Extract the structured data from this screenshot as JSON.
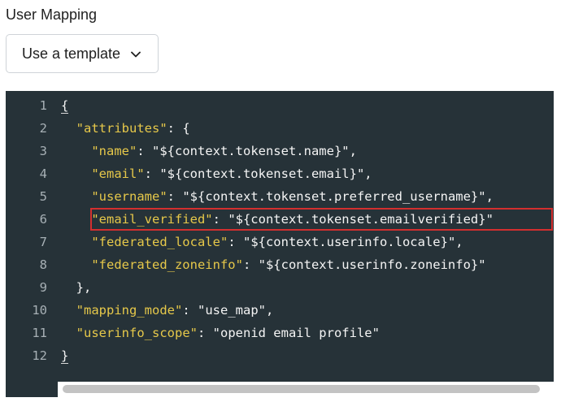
{
  "section": {
    "label": "User Mapping"
  },
  "template_dropdown": {
    "label": "Use a template",
    "icon": "chevron-down-icon"
  },
  "editor": {
    "line_numbers": [
      "1",
      "2",
      "3",
      "4",
      "5",
      "6",
      "7",
      "8",
      "9",
      "10",
      "11",
      "12"
    ],
    "lines": {
      "l1": {
        "open": "{"
      },
      "l2": {
        "key": "\"attributes\"",
        "rest": ": {"
      },
      "l3": {
        "key": "\"name\"",
        "sep": ": ",
        "val": "\"${context.tokenset.name}\"",
        "end": ","
      },
      "l4": {
        "key": "\"email\"",
        "sep": ": ",
        "val": "\"${context.tokenset.email}\"",
        "end": ","
      },
      "l5": {
        "key": "\"username\"",
        "sep": ": ",
        "val": "\"${context.tokenset.preferred_username}\"",
        "end": ","
      },
      "l6": {
        "key": "\"email_verified\"",
        "sep": ": ",
        "val": "\"${context.tokenset.emailverified}\""
      },
      "l7": {
        "key": "\"federated_locale\"",
        "sep": ": ",
        "val": "\"${context.userinfo.locale}\"",
        "end": ","
      },
      "l8": {
        "key": "\"federated_zoneinfo\"",
        "sep": ": ",
        "val": "\"${context.userinfo.zoneinfo}\""
      },
      "l9": {
        "text": "},"
      },
      "l10": {
        "key": "\"mapping_mode\"",
        "sep": ": ",
        "val": "\"use_map\"",
        "end": ","
      },
      "l11": {
        "key": "\"userinfo_scope\"",
        "sep": ": ",
        "val": "\"openid email profile\""
      },
      "l12": {
        "close": "}"
      }
    },
    "colors": {
      "background": "#263238",
      "key": "#e6c84a",
      "text": "#f4f4f4",
      "line_number": "#a7b0b5",
      "highlight_border": "#d32f2f"
    }
  }
}
